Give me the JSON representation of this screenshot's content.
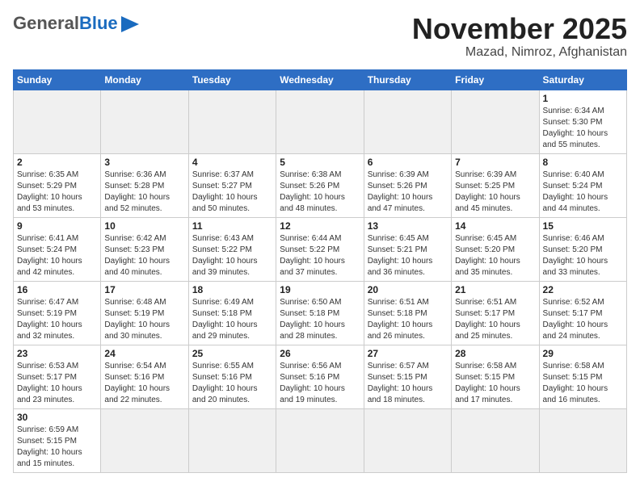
{
  "header": {
    "logo_general": "General",
    "logo_blue": "Blue",
    "title": "November 2025",
    "subtitle": "Mazad, Nimroz, Afghanistan"
  },
  "calendar": {
    "days_of_week": [
      "Sunday",
      "Monday",
      "Tuesday",
      "Wednesday",
      "Thursday",
      "Friday",
      "Saturday"
    ],
    "weeks": [
      [
        {
          "day": "",
          "info": ""
        },
        {
          "day": "",
          "info": ""
        },
        {
          "day": "",
          "info": ""
        },
        {
          "day": "",
          "info": ""
        },
        {
          "day": "",
          "info": ""
        },
        {
          "day": "",
          "info": ""
        },
        {
          "day": "1",
          "info": "Sunrise: 6:34 AM\nSunset: 5:30 PM\nDaylight: 10 hours and 55 minutes."
        }
      ],
      [
        {
          "day": "2",
          "info": "Sunrise: 6:35 AM\nSunset: 5:29 PM\nDaylight: 10 hours and 53 minutes."
        },
        {
          "day": "3",
          "info": "Sunrise: 6:36 AM\nSunset: 5:28 PM\nDaylight: 10 hours and 52 minutes."
        },
        {
          "day": "4",
          "info": "Sunrise: 6:37 AM\nSunset: 5:27 PM\nDaylight: 10 hours and 50 minutes."
        },
        {
          "day": "5",
          "info": "Sunrise: 6:38 AM\nSunset: 5:26 PM\nDaylight: 10 hours and 48 minutes."
        },
        {
          "day": "6",
          "info": "Sunrise: 6:39 AM\nSunset: 5:26 PM\nDaylight: 10 hours and 47 minutes."
        },
        {
          "day": "7",
          "info": "Sunrise: 6:39 AM\nSunset: 5:25 PM\nDaylight: 10 hours and 45 minutes."
        },
        {
          "day": "8",
          "info": "Sunrise: 6:40 AM\nSunset: 5:24 PM\nDaylight: 10 hours and 44 minutes."
        }
      ],
      [
        {
          "day": "9",
          "info": "Sunrise: 6:41 AM\nSunset: 5:24 PM\nDaylight: 10 hours and 42 minutes."
        },
        {
          "day": "10",
          "info": "Sunrise: 6:42 AM\nSunset: 5:23 PM\nDaylight: 10 hours and 40 minutes."
        },
        {
          "day": "11",
          "info": "Sunrise: 6:43 AM\nSunset: 5:22 PM\nDaylight: 10 hours and 39 minutes."
        },
        {
          "day": "12",
          "info": "Sunrise: 6:44 AM\nSunset: 5:22 PM\nDaylight: 10 hours and 37 minutes."
        },
        {
          "day": "13",
          "info": "Sunrise: 6:45 AM\nSunset: 5:21 PM\nDaylight: 10 hours and 36 minutes."
        },
        {
          "day": "14",
          "info": "Sunrise: 6:45 AM\nSunset: 5:20 PM\nDaylight: 10 hours and 35 minutes."
        },
        {
          "day": "15",
          "info": "Sunrise: 6:46 AM\nSunset: 5:20 PM\nDaylight: 10 hours and 33 minutes."
        }
      ],
      [
        {
          "day": "16",
          "info": "Sunrise: 6:47 AM\nSunset: 5:19 PM\nDaylight: 10 hours and 32 minutes."
        },
        {
          "day": "17",
          "info": "Sunrise: 6:48 AM\nSunset: 5:19 PM\nDaylight: 10 hours and 30 minutes."
        },
        {
          "day": "18",
          "info": "Sunrise: 6:49 AM\nSunset: 5:18 PM\nDaylight: 10 hours and 29 minutes."
        },
        {
          "day": "19",
          "info": "Sunrise: 6:50 AM\nSunset: 5:18 PM\nDaylight: 10 hours and 28 minutes."
        },
        {
          "day": "20",
          "info": "Sunrise: 6:51 AM\nSunset: 5:18 PM\nDaylight: 10 hours and 26 minutes."
        },
        {
          "day": "21",
          "info": "Sunrise: 6:51 AM\nSunset: 5:17 PM\nDaylight: 10 hours and 25 minutes."
        },
        {
          "day": "22",
          "info": "Sunrise: 6:52 AM\nSunset: 5:17 PM\nDaylight: 10 hours and 24 minutes."
        }
      ],
      [
        {
          "day": "23",
          "info": "Sunrise: 6:53 AM\nSunset: 5:17 PM\nDaylight: 10 hours and 23 minutes."
        },
        {
          "day": "24",
          "info": "Sunrise: 6:54 AM\nSunset: 5:16 PM\nDaylight: 10 hours and 22 minutes."
        },
        {
          "day": "25",
          "info": "Sunrise: 6:55 AM\nSunset: 5:16 PM\nDaylight: 10 hours and 20 minutes."
        },
        {
          "day": "26",
          "info": "Sunrise: 6:56 AM\nSunset: 5:16 PM\nDaylight: 10 hours and 19 minutes."
        },
        {
          "day": "27",
          "info": "Sunrise: 6:57 AM\nSunset: 5:15 PM\nDaylight: 10 hours and 18 minutes."
        },
        {
          "day": "28",
          "info": "Sunrise: 6:58 AM\nSunset: 5:15 PM\nDaylight: 10 hours and 17 minutes."
        },
        {
          "day": "29",
          "info": "Sunrise: 6:58 AM\nSunset: 5:15 PM\nDaylight: 10 hours and 16 minutes."
        }
      ],
      [
        {
          "day": "30",
          "info": "Sunrise: 6:59 AM\nSunset: 5:15 PM\nDaylight: 10 hours and 15 minutes."
        },
        {
          "day": "",
          "info": ""
        },
        {
          "day": "",
          "info": ""
        },
        {
          "day": "",
          "info": ""
        },
        {
          "day": "",
          "info": ""
        },
        {
          "day": "",
          "info": ""
        },
        {
          "day": "",
          "info": ""
        }
      ]
    ]
  }
}
